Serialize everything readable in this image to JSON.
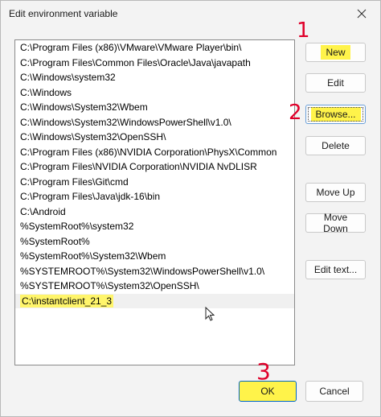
{
  "window": {
    "title": "Edit environment variable"
  },
  "paths": [
    "C:\\Program Files (x86)\\VMware\\VMware Player\\bin\\",
    "C:\\Program Files\\Common Files\\Oracle\\Java\\javapath",
    "C:\\Windows\\system32",
    "C:\\Windows",
    "C:\\Windows\\System32\\Wbem",
    "C:\\Windows\\System32\\WindowsPowerShell\\v1.0\\",
    "C:\\Windows\\System32\\OpenSSH\\",
    "C:\\Program Files (x86)\\NVIDIA Corporation\\PhysX\\Common",
    "C:\\Program Files\\NVIDIA Corporation\\NVIDIA NvDLISR",
    "C:\\Program Files\\Git\\cmd",
    "C:\\Program Files\\Java\\jdk-16\\bin",
    "C:\\Android",
    "%SystemRoot%\\system32",
    "%SystemRoot%",
    "%SystemRoot%\\System32\\Wbem",
    "%SYSTEMROOT%\\System32\\WindowsPowerShell\\v1.0\\",
    "%SYSTEMROOT%\\System32\\OpenSSH\\",
    "C:\\instantclient_21_3"
  ],
  "buttons": {
    "new": "New",
    "edit": "Edit",
    "browse": "Browse...",
    "delete": "Delete",
    "move_up": "Move Up",
    "move_down": "Move Down",
    "edit_text": "Edit text...",
    "ok": "OK",
    "cancel": "Cancel"
  },
  "annotations": {
    "step1": "1",
    "step2": "2",
    "step3": "3",
    "color": "#e0002a",
    "highlight_color": "#fff34a"
  },
  "icons": {
    "close": "close-icon",
    "cursor": "mouse-pointer-icon"
  }
}
